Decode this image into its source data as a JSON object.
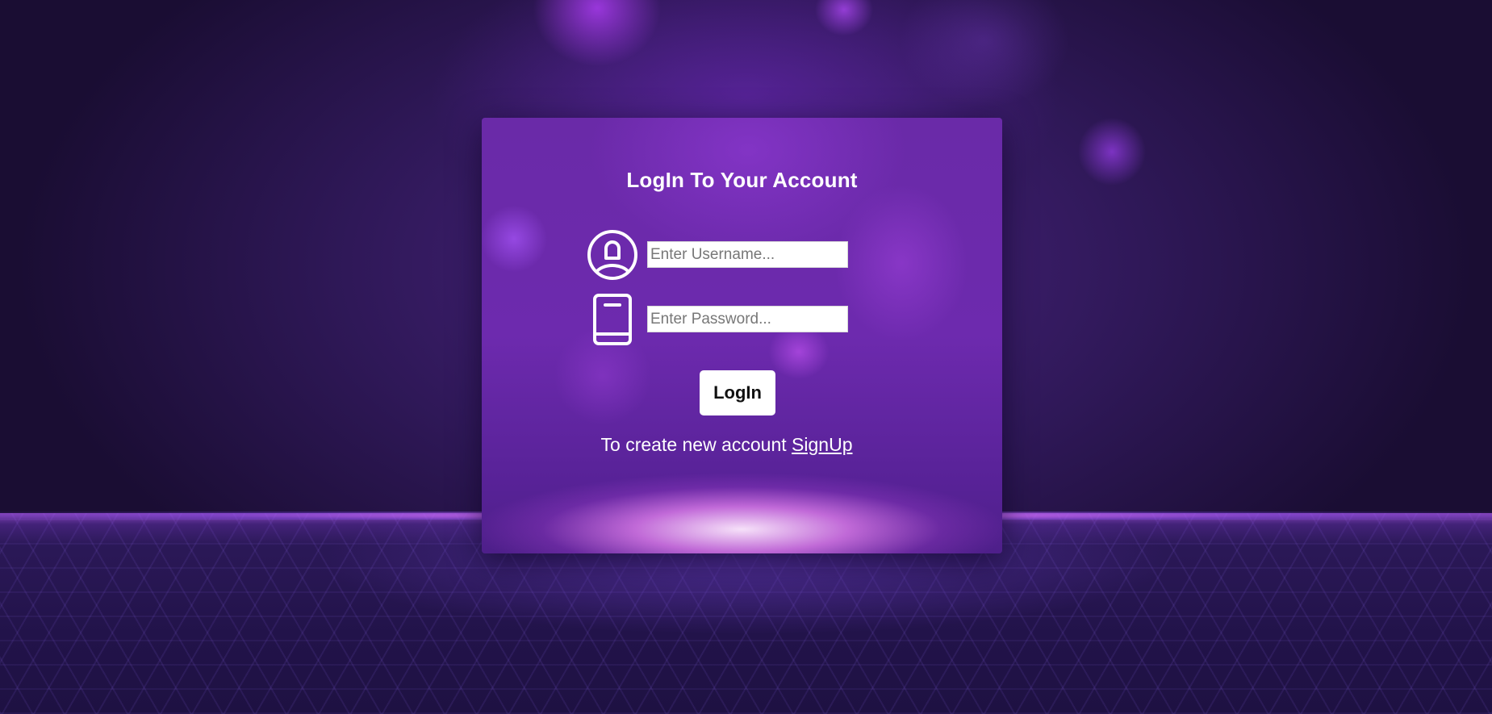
{
  "login_card": {
    "title": "LogIn To Your Account",
    "username": {
      "placeholder": "Enter Username...",
      "value": ""
    },
    "password": {
      "placeholder": "Enter Password...",
      "value": ""
    },
    "login_button_label": "LogIn",
    "signup_prompt": "To create new account",
    "signup_link_label": "SignUp"
  },
  "icons": {
    "username": "user-circle-icon",
    "password": "book-icon"
  },
  "colors": {
    "card_purple": "#6d2aae",
    "background_dark": "#2f1858",
    "glow_pink": "#e68cf5",
    "text": "#ffffff",
    "button_bg": "#ffffff"
  }
}
